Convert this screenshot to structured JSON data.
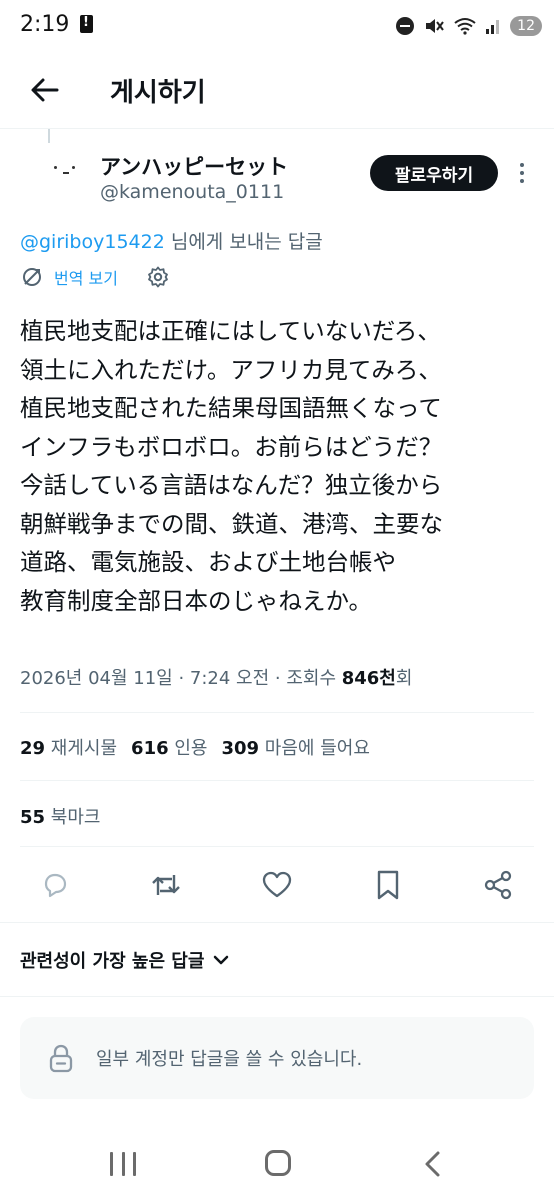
{
  "status_bar": {
    "time": "2:19",
    "notification_count": "12"
  },
  "header": {
    "title": "게시하기",
    "back_icon": "arrow-left-icon"
  },
  "author": {
    "name": "アンハッピーセット",
    "handle": "@kamenouta_0111",
    "follow_label": "팔로우하기"
  },
  "reply_to": {
    "mention": "@giriboy15422",
    "suffix": " 님에게 보내는 답글"
  },
  "translate": {
    "label": "번역 보기"
  },
  "tweet": {
    "text": "植民地支配は正確にはしていないだろ、\n領土に入れただけ。アフリカ見てみろ、\n植民地支配された結果母国語無くなって\nインフラもボロボロ。お前らはどうだ？\n今話している言語はなんだ？独立後から\n朝鮮戦争までの間、鉄道、港湾、主要な\n道路、電気施設、および土地台帳や\n教育制度全部日本のじゃねえか。"
  },
  "meta": {
    "datetime": "2026년 04월 11일 · 7:24 오전 · 조회수 ",
    "views": "846천",
    "views_suffix": "회"
  },
  "stats": {
    "reposts_count": "29",
    "reposts_label": "재게시물",
    "quotes_count": "616",
    "quotes_label": "인용",
    "likes_count": "309",
    "likes_label": "마음에 들어요",
    "bookmarks_count": "55",
    "bookmarks_label": "북마크"
  },
  "actions": [
    "reply-icon",
    "repost-icon",
    "like-icon",
    "bookmark-icon",
    "share-icon"
  ],
  "sort": {
    "label": "관련성이 가장 높은 답글"
  },
  "reply_restricted": {
    "message": "일부 계정만 답글을 쓸 수 있습니다."
  },
  "colors": {
    "accent": "#1d9bf0",
    "text": "#0f1419",
    "secondary": "#536471"
  }
}
